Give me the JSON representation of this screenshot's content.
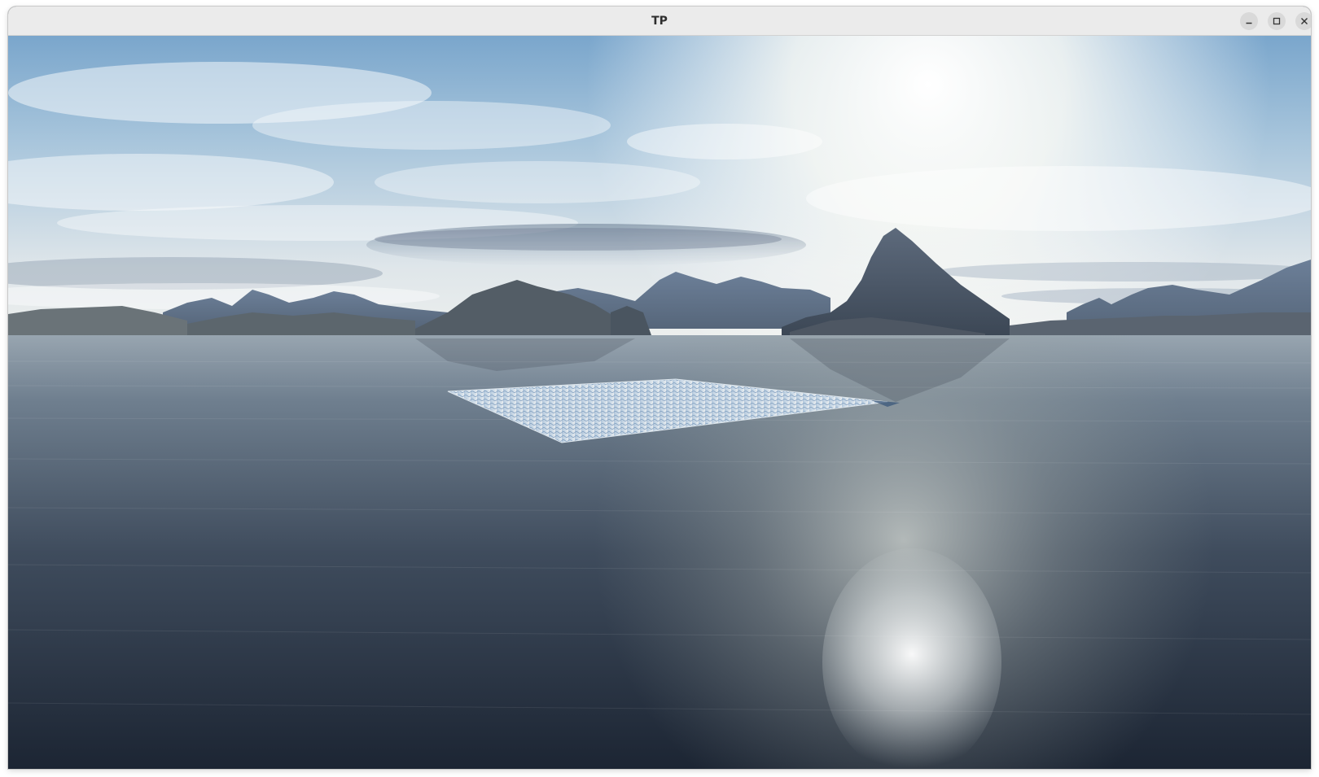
{
  "window": {
    "title": "TP",
    "controls": {
      "minimize_icon": "minimize-icon",
      "maximize_icon": "maximize-icon",
      "close_icon": "close-icon"
    }
  },
  "scene": {
    "description_icon": "3d-render-viewport",
    "colors": {
      "sky_top": "#6f9ec9",
      "sky_horizon": "#e9eef0",
      "sun_glow": "#ffffff",
      "mountain": "#4a5565",
      "water_far": "#8d9ba7",
      "water_near": "#1f2836",
      "water_patch": "#c9d9e8"
    }
  }
}
